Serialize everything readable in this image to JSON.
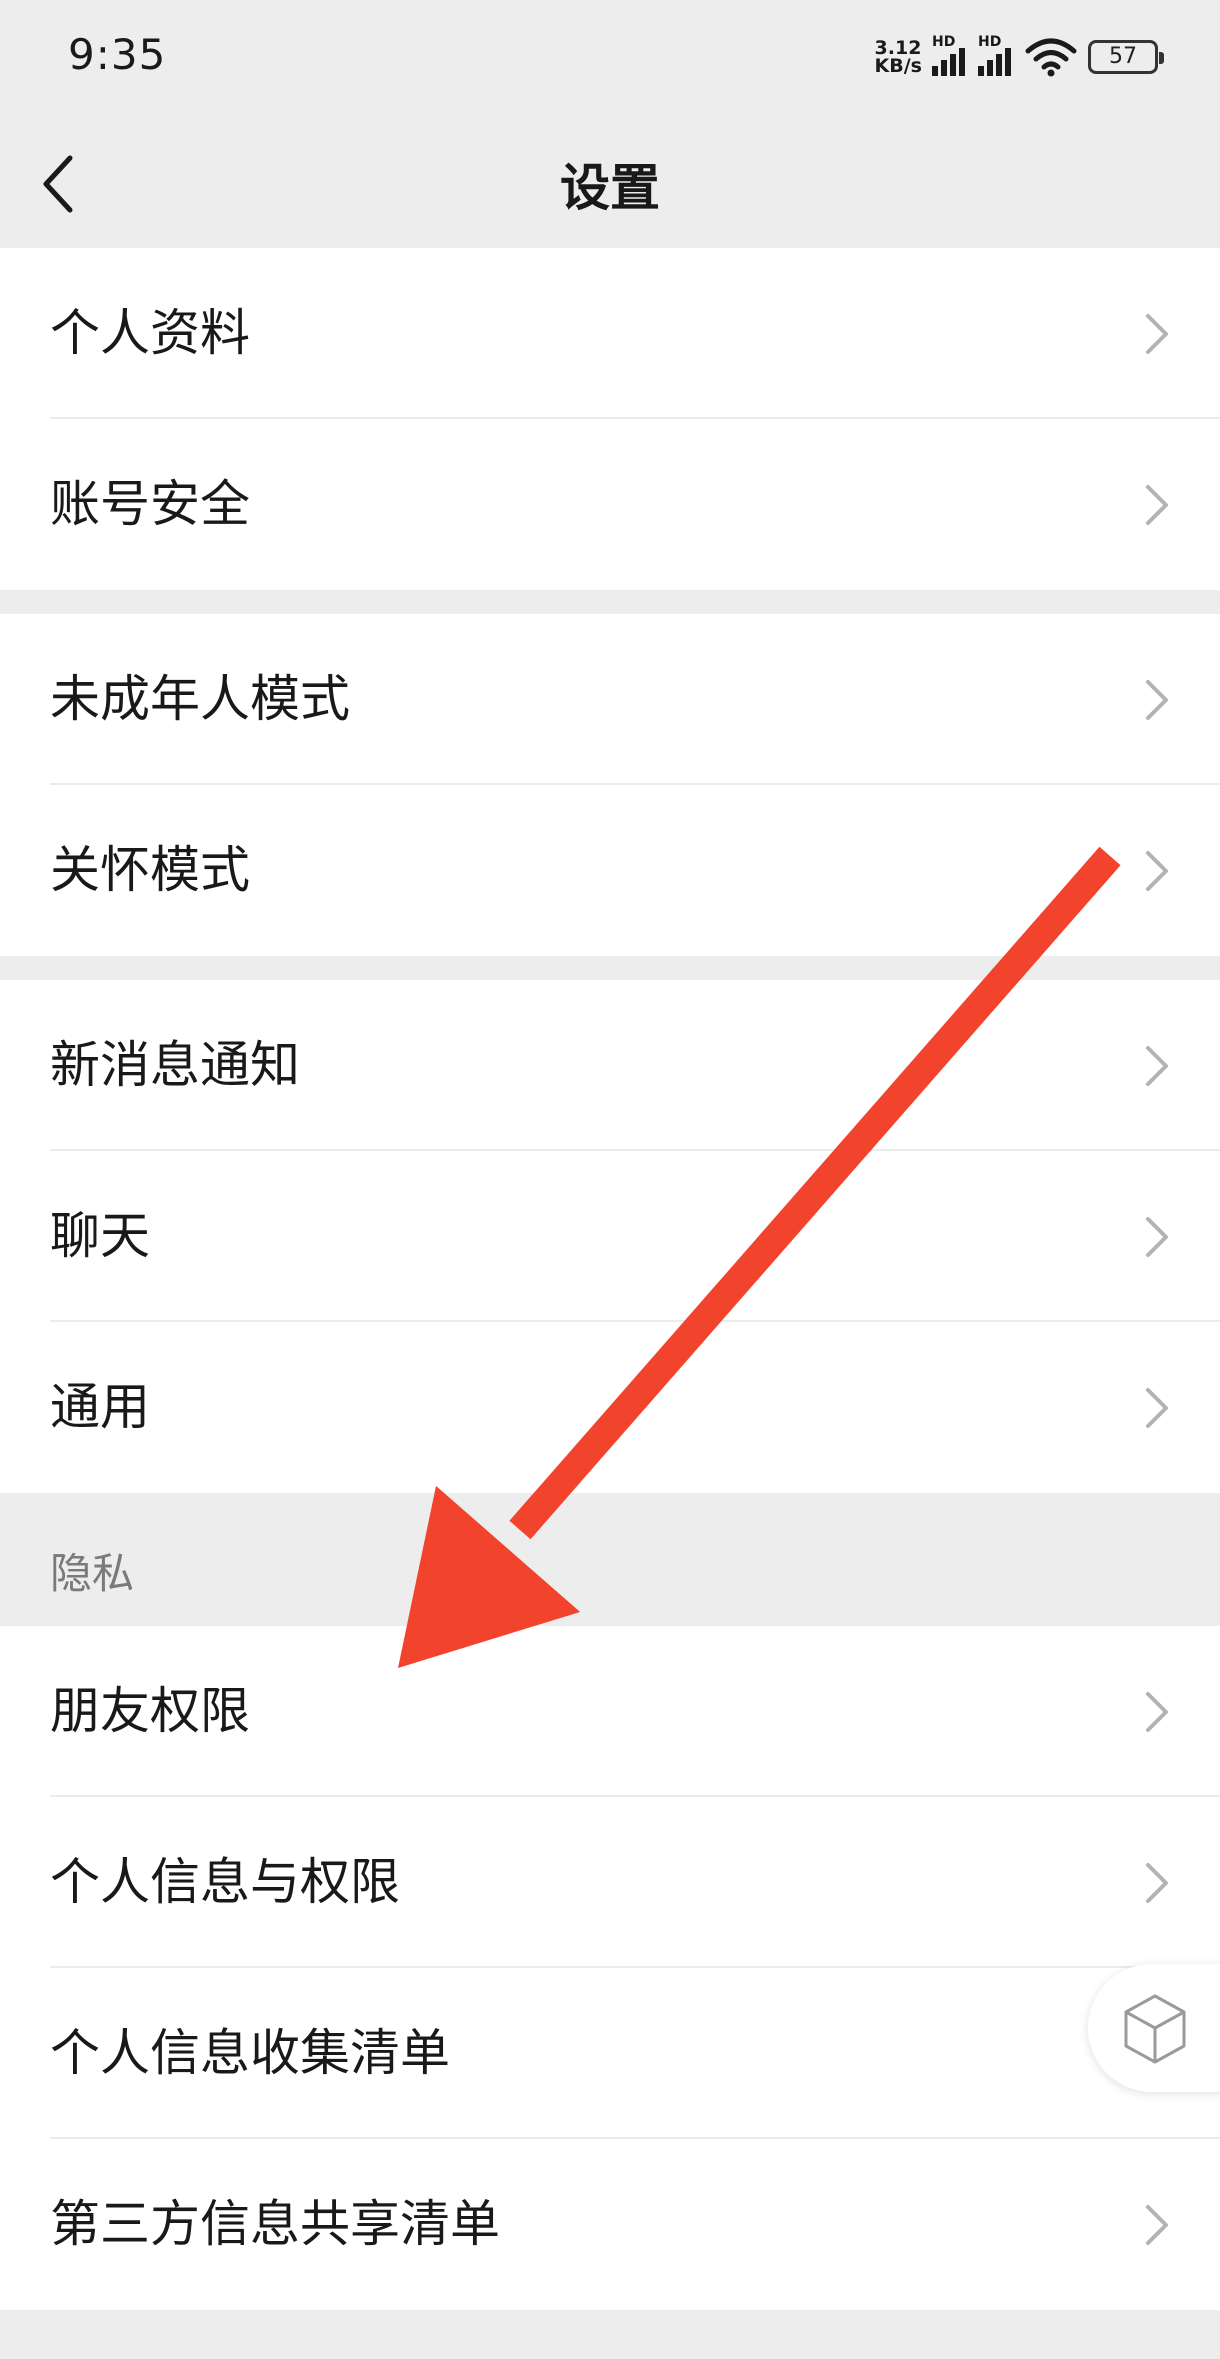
{
  "status_bar": {
    "time": "9:35",
    "net_speed_value": "3.12",
    "net_speed_unit": "KB/s",
    "signal1_label": "HD",
    "signal2_label": "HD",
    "battery": "57",
    "icons": [
      "signal-icon",
      "wifi-icon",
      "battery-icon"
    ]
  },
  "nav": {
    "title": "设置",
    "back_icon": "chevron-left-icon"
  },
  "groups": [
    {
      "items": [
        "个人资料",
        "账号安全"
      ]
    },
    {
      "items": [
        "未成年人模式",
        "关怀模式"
      ]
    },
    {
      "items": [
        "新消息通知",
        "聊天",
        "通用"
      ]
    },
    {
      "header": "隐私",
      "items": [
        "朋友权限",
        "个人信息与权限",
        "个人信息收集清单",
        "第三方信息共享清单"
      ]
    }
  ],
  "colors": {
    "background": "#ededed",
    "row_background": "#ffffff",
    "annotation_arrow": "#f2432c"
  },
  "floating_button_icon": "cube-icon",
  "annotation": "arrow-icon pointing to 朋友权限"
}
